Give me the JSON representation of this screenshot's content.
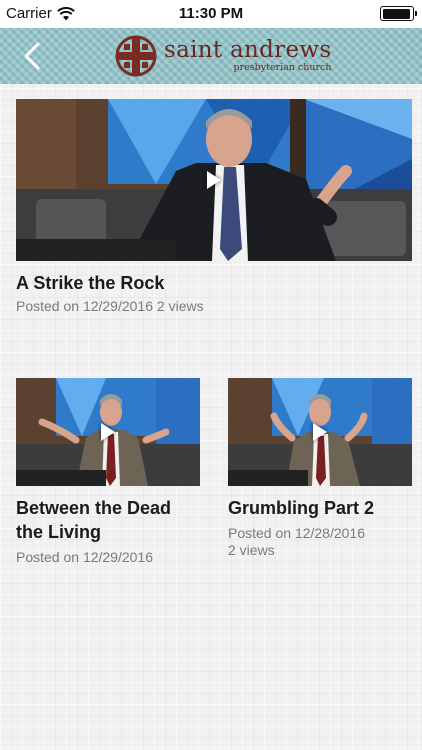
{
  "status_bar": {
    "carrier": "Carrier",
    "time": "11:30 PM"
  },
  "header": {
    "logo_name": "saint andrews",
    "logo_sub": "presbyterian church"
  },
  "videos": [
    {
      "title": "A Strike the Rock",
      "posted": "Posted on 12/29/2016",
      "views": "2 views"
    },
    {
      "title": "Between the Dead  the Living",
      "posted": "Posted on 12/29/2016",
      "views": ""
    },
    {
      "title": "Grumbling Part 2",
      "posted": "Posted on 12/28/2016",
      "views": "2 views"
    }
  ],
  "colors": {
    "header": "#8fc2c6",
    "logo": "#6b2520",
    "stained_glass": "#3b8fd8"
  },
  "icons": [
    "wifi-icon",
    "battery-icon",
    "back-chevron-icon",
    "cross-logo-icon",
    "play-icon"
  ]
}
